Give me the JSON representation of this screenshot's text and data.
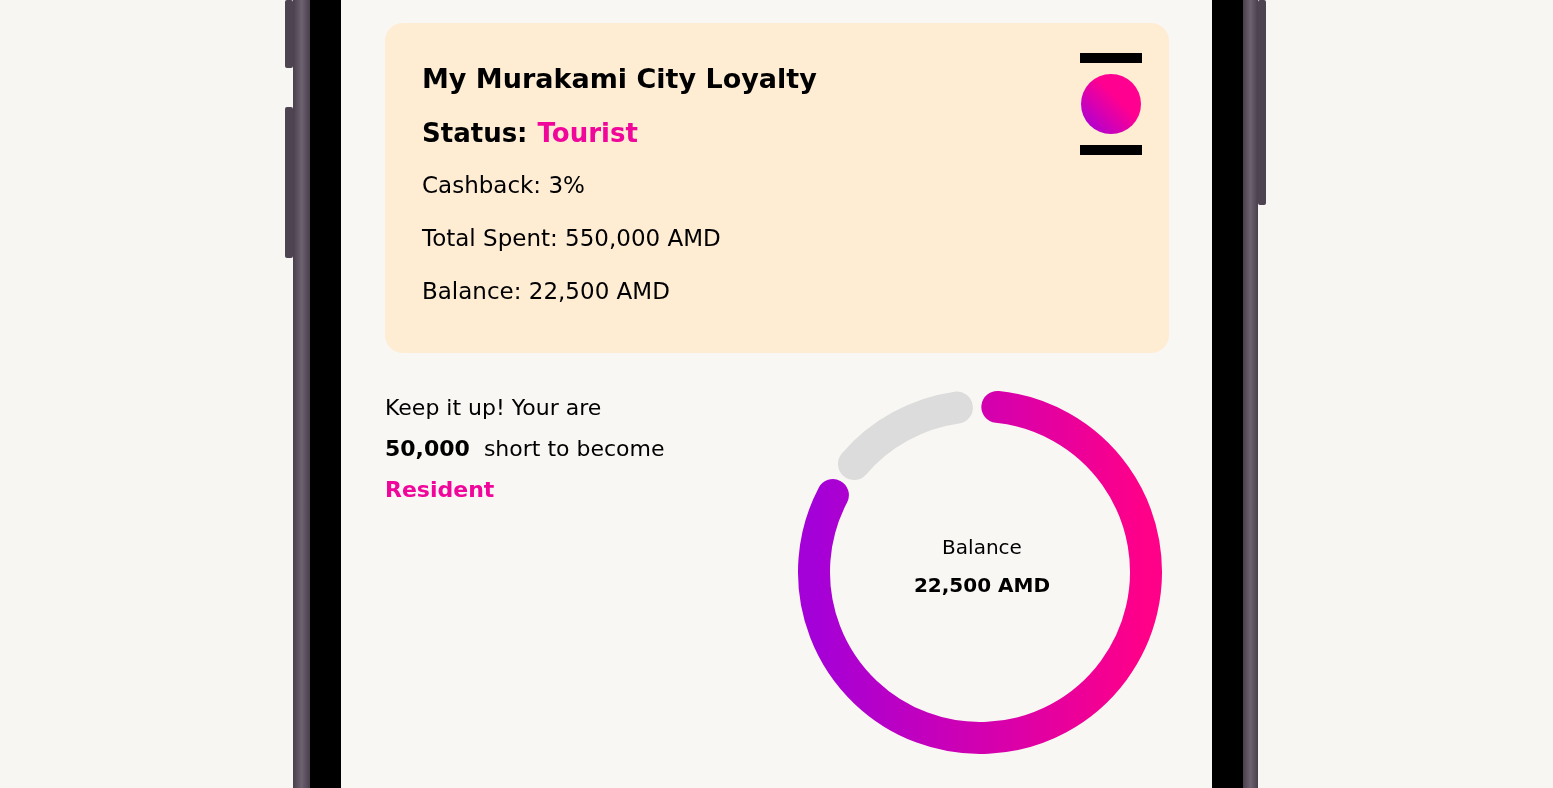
{
  "card": {
    "title": "My Murakami City Loyalty",
    "status_label": "Status:",
    "status_value": "Tourist",
    "rows": [
      "Cashback: 3%",
      "Total Spent: 550,000 AMD",
      "Balance: 22,500 AMD"
    ]
  },
  "progress": {
    "message_lines": [
      "Keep it up! Your are",
      "**50,000**  short to become"
    ],
    "next_status": "Resident",
    "center_label": "Balance",
    "center_value": "22,500 AMD"
  }
}
